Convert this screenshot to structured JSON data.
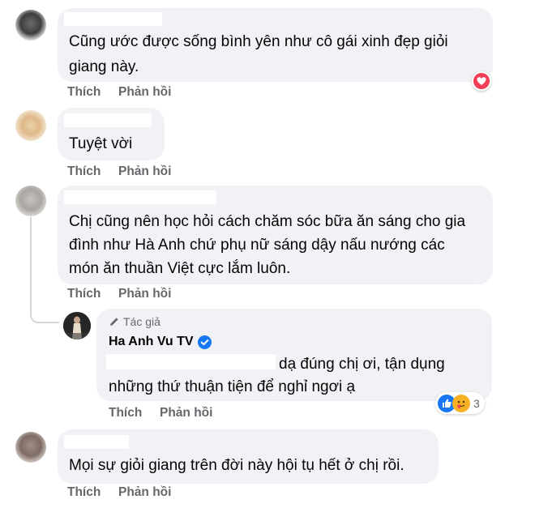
{
  "comments": [
    {
      "text_lines": [
        "Cũng ước được sống bình yên như cô gái xinh đẹp giỏi",
        "giang này."
      ],
      "like_label": "Thích",
      "reply_label": "Phản hồi",
      "reaction": "heart-icon"
    },
    {
      "text_lines": [
        "Tuyệt vời"
      ],
      "like_label": "Thích",
      "reply_label": "Phản hồi"
    },
    {
      "text_lines": [
        "Chị cũng nên học hỏi cách chăm sóc bữa ăn sáng cho gia",
        "đình như Hà Anh chứ phụ nữ sáng dậy nấu nướng các",
        "món ăn thuần Việt cực lắm luôn."
      ],
      "like_label": "Thích",
      "reply_label": "Phản hồi"
    },
    {
      "text_lines": [
        "Mọi sự giỏi giang trên đời này hội tụ hết ở chị rồi."
      ],
      "like_label": "Thích",
      "reply_label": "Phản hồi"
    }
  ],
  "reply": {
    "author_badge": "Tác giả",
    "author_name": "Ha Anh Vu TV",
    "text_lines": [
      "dạ đúng chị ơi, tận dụng",
      "những thứ thuận tiện để nghỉ ngơi ạ"
    ],
    "like_label": "Thích",
    "reply_label": "Phản hồi",
    "reaction_count": "3"
  },
  "colors": {
    "bubble": "#f0f2f5",
    "secondary_text": "#65676b",
    "like_blue": "#1877f2",
    "love_red": "#f33e58",
    "verified_blue": "#1877f2"
  }
}
